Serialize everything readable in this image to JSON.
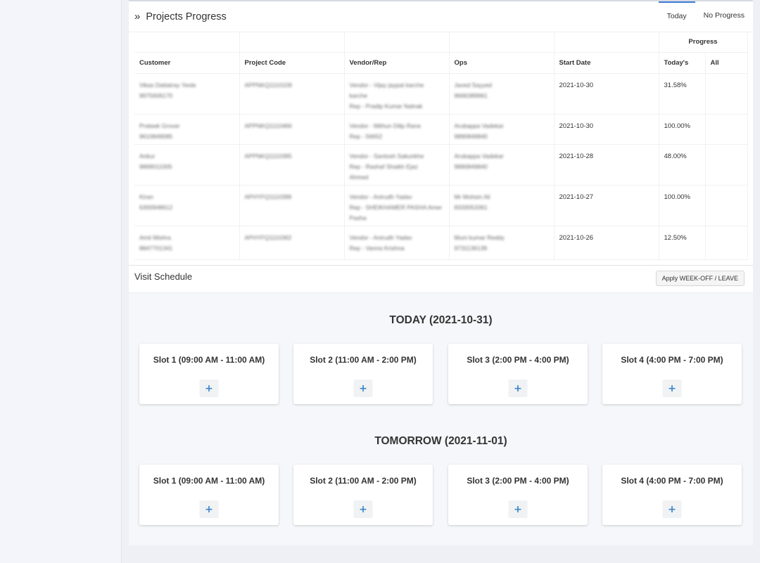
{
  "projects": {
    "title": "Projects Progress",
    "tabs": [
      "Today",
      "No Progress"
    ],
    "columns": {
      "customer": "Customer",
      "project_code": "Project Code",
      "vendor_rep": "Vendor/Rep",
      "ops": "Ops",
      "start_date": "Start Date",
      "progress": "Progress",
      "todays": "Today's",
      "all": "All"
    },
    "rows": [
      {
        "customer": [
          "Vikas Dattatray Yeole",
          "9975606170"
        ],
        "code": "APPNKQ1110109",
        "vendor": [
          "Vendor - Vijay jaypat karche",
          "karche",
          "Rep - Pradip Kumar Nalnak"
        ],
        "ops": [
          "Javed Sayyed",
          "9666389961"
        ],
        "start": "2021-10-30",
        "today": "31.58%"
      },
      {
        "customer": [
          "Prateek Grover",
          "9610849085"
        ],
        "code": "APPNKQ1110466",
        "vendor": [
          "Vendor - Mithun Dilip Rane",
          "Rep - 56652"
        ],
        "ops": [
          "Arubappa Vadekar",
          "9890849840"
        ],
        "start": "2021-10-30",
        "today": "100.00%"
      },
      {
        "customer": [
          "Ankur",
          "9869011005"
        ],
        "code": "APPNKQ1110395",
        "vendor": [
          "Vendor - Santosh Sakunkhe",
          "Rep - Rashaf Shaikh Ejaz",
          "Ahmed"
        ],
        "ops": [
          "Arubappa Vadekar",
          "9890849840"
        ],
        "start": "2021-10-28",
        "today": "48.00%"
      },
      {
        "customer": [
          "Kiran",
          "6300948612"
        ],
        "code": "APHYFQ1110399",
        "vendor": [
          "Vendor - Anirudh Yadav",
          "Rep - SHEIKHAMER PASHA Amer",
          "Pasha"
        ],
        "ops": [
          "Mr Mohsin Ali",
          "8333053361"
        ],
        "start": "2021-10-27",
        "today": "100.00%"
      },
      {
        "customer": [
          "Amit Mishra",
          "8847701341"
        ],
        "code": "APHYFQ1110362",
        "vendor": [
          "Vendor - Anirudh Yadav",
          "Rep - Vanna Krishna"
        ],
        "ops": [
          "Muni kumar Reddy",
          "9731136139"
        ],
        "start": "2021-10-26",
        "today": "12.50%"
      }
    ]
  },
  "visit": {
    "title": "Visit Schedule",
    "apply_button": "Apply WEEK-OFF / LEAVE",
    "days": [
      {
        "heading": "TODAY (2021-10-31)",
        "slots": [
          "Slot 1 (09:00 AM - 11:00 AM)",
          "Slot 2 (11:00 AM - 2:00 PM)",
          "Slot 3 (2:00 PM - 4:00 PM)",
          "Slot 4 (4:00 PM - 7:00 PM)"
        ]
      },
      {
        "heading": "TOMORROW (2021-11-01)",
        "slots": [
          "Slot 1 (09:00 AM - 11:00 AM)",
          "Slot 2 (11:00 AM - 2:00 PM)",
          "Slot 3 (2:00 PM - 4:00 PM)",
          "Slot 4 (4:00 PM - 7:00 PM)"
        ]
      }
    ],
    "add_symbol": "+"
  },
  "colors": {
    "accent": "#3a7bd5",
    "progress": "#28a745",
    "plus": "#3a85c9"
  },
  "icons": {
    "title_icon": "double-chevron-right-icon",
    "add_icon": "plus-icon"
  }
}
